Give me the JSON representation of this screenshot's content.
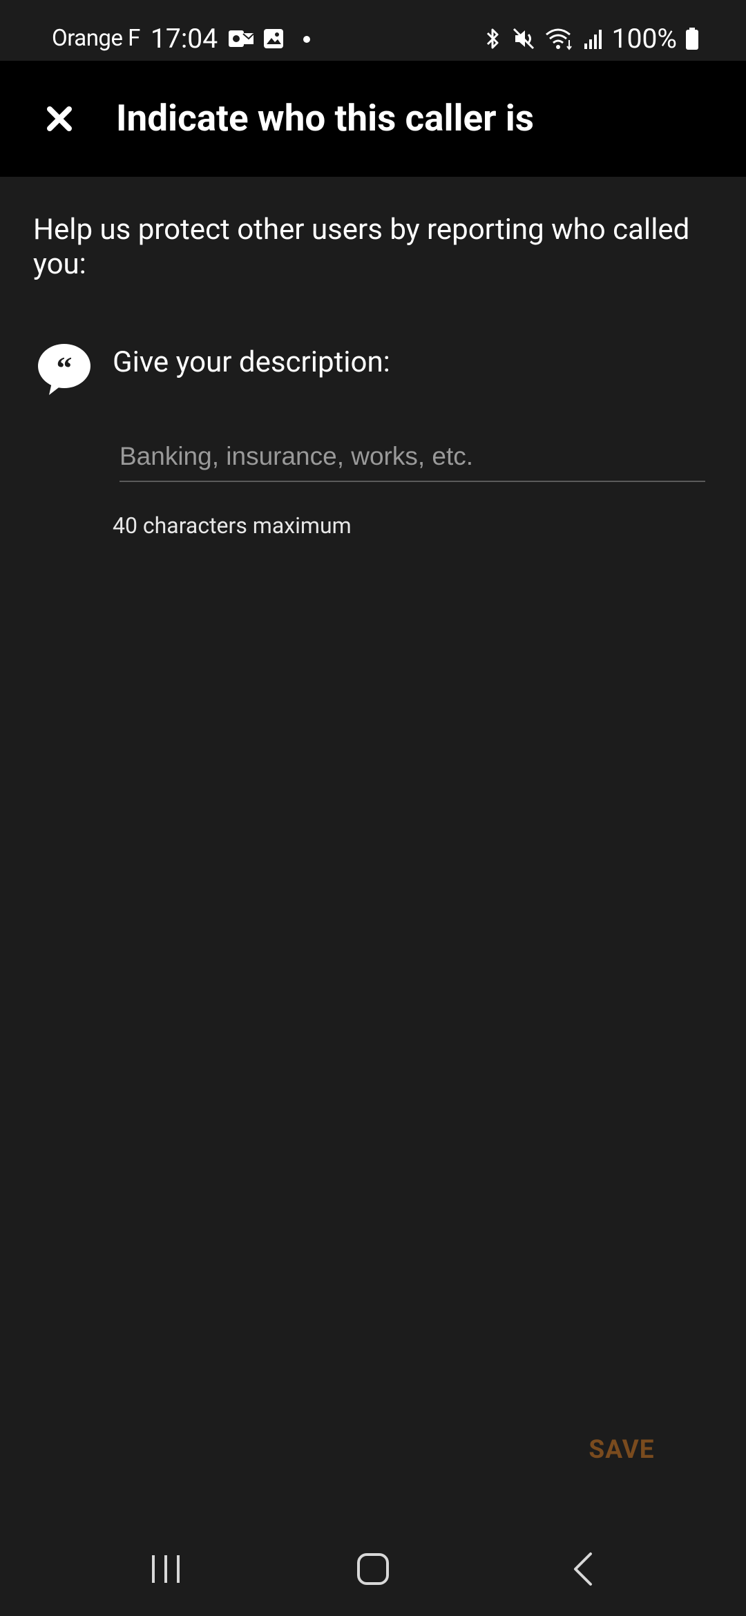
{
  "status_bar": {
    "carrier": "Orange F",
    "time": "17:04",
    "battery": "100%",
    "icons": [
      "outlook-icon",
      "gallery-icon",
      "dot-icon",
      "bluetooth-icon",
      "mute-icon",
      "wifi-icon",
      "signal-icon",
      "battery-icon"
    ]
  },
  "app_bar": {
    "title": "Indicate who this caller is",
    "close_icon": "close-icon"
  },
  "main": {
    "intro": "Help us protect other users by reporting who called you:",
    "description_label": "Give your description:",
    "description_placeholder": "Banking, insurance, works, etc.",
    "description_value": "",
    "hint": "40 characters maximum",
    "quote_icon": "quote-bubble-icon"
  },
  "actions": {
    "save_label": "SAVE",
    "save_color": "#7a4b1e"
  },
  "nav": {
    "icons": [
      "recent-apps-icon",
      "home-icon",
      "back-icon"
    ]
  }
}
